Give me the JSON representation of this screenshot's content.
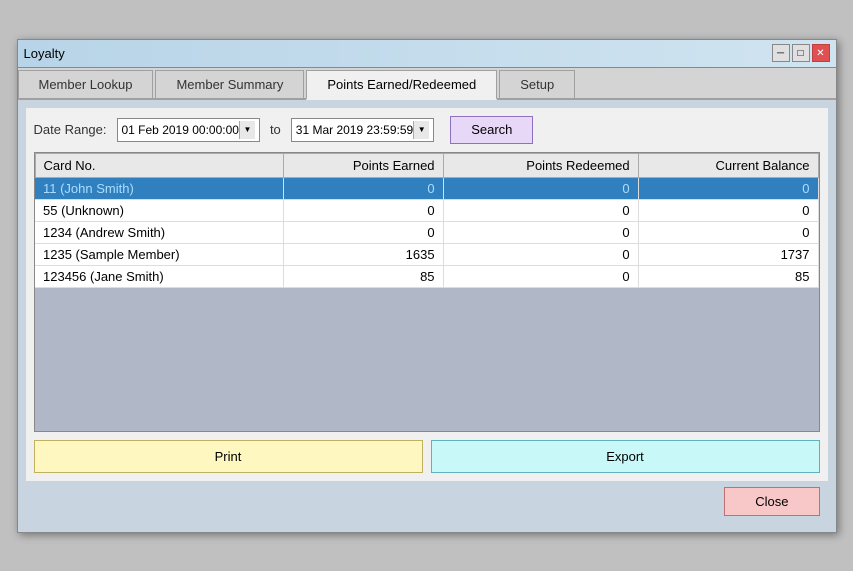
{
  "window": {
    "title": "Loyalty",
    "title_btn_min": "─",
    "title_btn_max": "□",
    "title_btn_close": "✕"
  },
  "tabs": [
    {
      "label": "Member Lookup",
      "active": false
    },
    {
      "label": "Member Summary",
      "active": false
    },
    {
      "label": "Points Earned/Redeemed",
      "active": true
    },
    {
      "label": "Setup",
      "active": false
    }
  ],
  "date_range": {
    "label": "Date Range:",
    "from": "01 Feb 2019  00:00:00",
    "to_label": "to",
    "to": "31 Mar 2019  23:59:59",
    "search_label": "Search"
  },
  "table": {
    "columns": [
      "Card No.",
      "Points Earned",
      "Points Redeemed",
      "Current Balance"
    ],
    "rows": [
      {
        "card": "11 (John Smith)",
        "earned": "0",
        "redeemed": "0",
        "balance": "0",
        "selected": true
      },
      {
        "card": "55 (Unknown)",
        "earned": "0",
        "redeemed": "0",
        "balance": "0",
        "selected": false
      },
      {
        "card": "1234 (Andrew Smith)",
        "earned": "0",
        "redeemed": "0",
        "balance": "0",
        "selected": false
      },
      {
        "card": "1235 (Sample Member)",
        "earned": "1635",
        "redeemed": "0",
        "balance": "1737",
        "selected": false
      },
      {
        "card": "123456 (Jane Smith)",
        "earned": "85",
        "redeemed": "0",
        "balance": "85",
        "selected": false
      }
    ]
  },
  "buttons": {
    "print": "Print",
    "export": "Export",
    "close": "Close"
  }
}
